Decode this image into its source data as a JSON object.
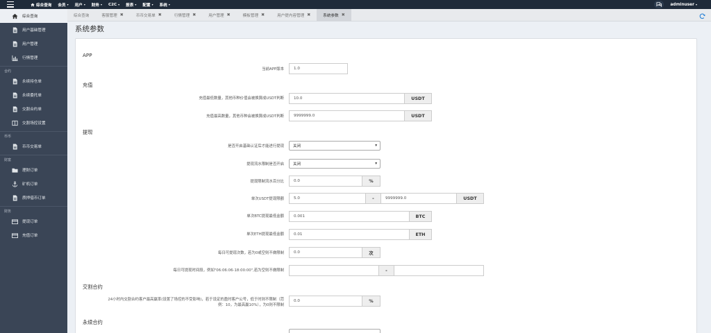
{
  "topbar": {
    "nav": [
      {
        "label": "综合查询",
        "icon": "home-icon",
        "caret": false
      },
      {
        "label": "会员",
        "caret": true
      },
      {
        "label": "用户",
        "caret": true
      },
      {
        "label": "财务",
        "caret": true
      },
      {
        "label": "C2C",
        "caret": true
      },
      {
        "label": "报表",
        "caret": true
      },
      {
        "label": "配置",
        "caret": true
      },
      {
        "label": "系统",
        "caret": true
      }
    ],
    "username": "adminuser",
    "caret": "▾"
  },
  "sidebar": {
    "items": [
      {
        "label": "综合查询",
        "icon": "home-icon"
      },
      {
        "label": "用户基础管理",
        "icon": "document-icon"
      },
      {
        "label": "用户管理",
        "icon": "document-icon"
      },
      {
        "label": "行情管理",
        "icon": "bar-chart-icon"
      }
    ],
    "section_contract": "合约",
    "contract_items": [
      {
        "label": "永续持仓单",
        "icon": "document-icon"
      },
      {
        "label": "永续委托单",
        "icon": "document-icon"
      },
      {
        "label": "交割合约单",
        "icon": "document-icon"
      },
      {
        "label": "交割场控设置",
        "icon": "columns-icon"
      }
    ],
    "section_coin": "币币",
    "coin_items": [
      {
        "label": "币币交易单",
        "icon": "document-icon"
      }
    ],
    "section_wealth": "财富",
    "wealth_items": [
      {
        "label": "理财订单",
        "icon": "folder-icon"
      },
      {
        "label": "矿机订单",
        "icon": "anchor-icon"
      },
      {
        "label": "质押借币订单",
        "icon": "document-icon"
      }
    ],
    "section_finance": "财务",
    "finance_items": [
      {
        "label": "提现订单",
        "icon": "card-icon"
      },
      {
        "label": "充值订单",
        "icon": "card-icon"
      }
    ]
  },
  "tabs": [
    {
      "label": "综合查询",
      "closable": false,
      "active": false
    },
    {
      "label": "客服管理",
      "closable": true,
      "active": false
    },
    {
      "label": "币币交易单",
      "closable": true,
      "active": false
    },
    {
      "label": "行情管理",
      "closable": true,
      "active": false
    },
    {
      "label": "用户管理",
      "closable": true,
      "active": false
    },
    {
      "label": "模板管理",
      "closable": true,
      "active": false
    },
    {
      "label": "用户提内容管理",
      "closable": true,
      "active": false
    },
    {
      "label": "系统参数",
      "closable": true,
      "active": true
    }
  ],
  "tab_close": "✖",
  "page_title": "系统参数",
  "sections": {
    "app": "APP",
    "recharge": "充值",
    "withdraw": "提现",
    "delivery": "交割合约",
    "perpetual": "永续合约"
  },
  "form": {
    "app_version": {
      "label": "当前APP版本",
      "value": "1.0"
    },
    "recharge_min": {
      "label": "充值最低数量，其他币种价值会被换算成USDT判断",
      "value": "10.0",
      "unit": "USDT"
    },
    "recharge_max": {
      "label": "充值最高数量，其他币种会被换算成USDT判断",
      "value": "9999999.0",
      "unit": "USDT"
    },
    "withdraw_kyc": {
      "label": "是否开启基础认证后才能进行提现",
      "value": "关闭"
    },
    "withdraw_flow": {
      "label": "提现流水限制是否开启",
      "value": "关闭"
    },
    "withdraw_flow_pct": {
      "label": "提现限制流水百分比",
      "value": "0.0",
      "unit": "%"
    },
    "withdraw_usdt_limit": {
      "label": "单次USDT提现限额",
      "min": "5.0",
      "sep": "-",
      "max": "9999999.0",
      "unit": "USDT"
    },
    "withdraw_btc_min": {
      "label": "单次BTC提现最低金额",
      "value": "0.001",
      "unit": "BTC"
    },
    "withdraw_eth_min": {
      "label": "单次ETH提现最低金额",
      "value": "0.01",
      "unit": "ETH"
    },
    "withdraw_daily_count": {
      "label": "每日可提现次数，若为0或空则不做限制",
      "value": "0.0",
      "unit": "次"
    },
    "withdraw_time": {
      "label": "每日可提现时间段，例如\"06:06:06-18:00:00\",若为空则不做限制",
      "start": "",
      "sep": "-",
      "end": ""
    },
    "delivery_limit": {
      "label_line1": "24小时内交割合约客户最高赢率(设置了场控的不受影响)，若于设定的盈时客户公号，低于时则不限制（范",
      "label_line2": "例：10，为最高赢10%），为0则不限制",
      "value": "0.0",
      "unit": "%"
    }
  },
  "colors": {
    "topbar": "#1f2b3a",
    "sidebar": "#3a4556",
    "accent": "#2a83d7"
  }
}
